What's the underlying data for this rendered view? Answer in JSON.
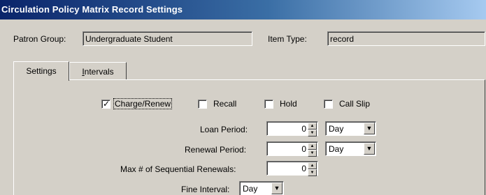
{
  "window": {
    "title": "Circulation Policy Matrix Record Settings"
  },
  "header": {
    "patron_group_label": "Patron Group:",
    "patron_group_value": "Undergraduate Student",
    "item_type_label": "Item Type:",
    "item_type_value": "record"
  },
  "tabs": [
    {
      "label": "Settings",
      "active": true
    },
    {
      "label_pre": "",
      "label_u": "I",
      "label_post": "ntervals",
      "active": false
    }
  ],
  "checkboxes": [
    {
      "label": "Charge/Renew",
      "checked": true,
      "focused": true
    },
    {
      "label": "Recall",
      "checked": false
    },
    {
      "label": "Hold",
      "checked": false
    },
    {
      "label": "Call Slip",
      "checked": false
    }
  ],
  "fields": {
    "loan_period_label": "Loan Period:",
    "loan_period_value": "0",
    "loan_period_unit": "Day",
    "renewal_period_label": "Renewal Period:",
    "renewal_period_value": "0",
    "renewal_period_unit": "Day",
    "max_renewals_label": "Max # of Sequential Renewals:",
    "max_renewals_value": "0",
    "fine_interval_label": "Fine Interval:",
    "fine_interval_value": "Day"
  },
  "icons": {
    "spin_up": "spin-up-arrow-icon",
    "spin_down": "spin-down-arrow-icon",
    "dropdown": "dropdown-arrow-icon",
    "check": "check-mark-icon"
  }
}
